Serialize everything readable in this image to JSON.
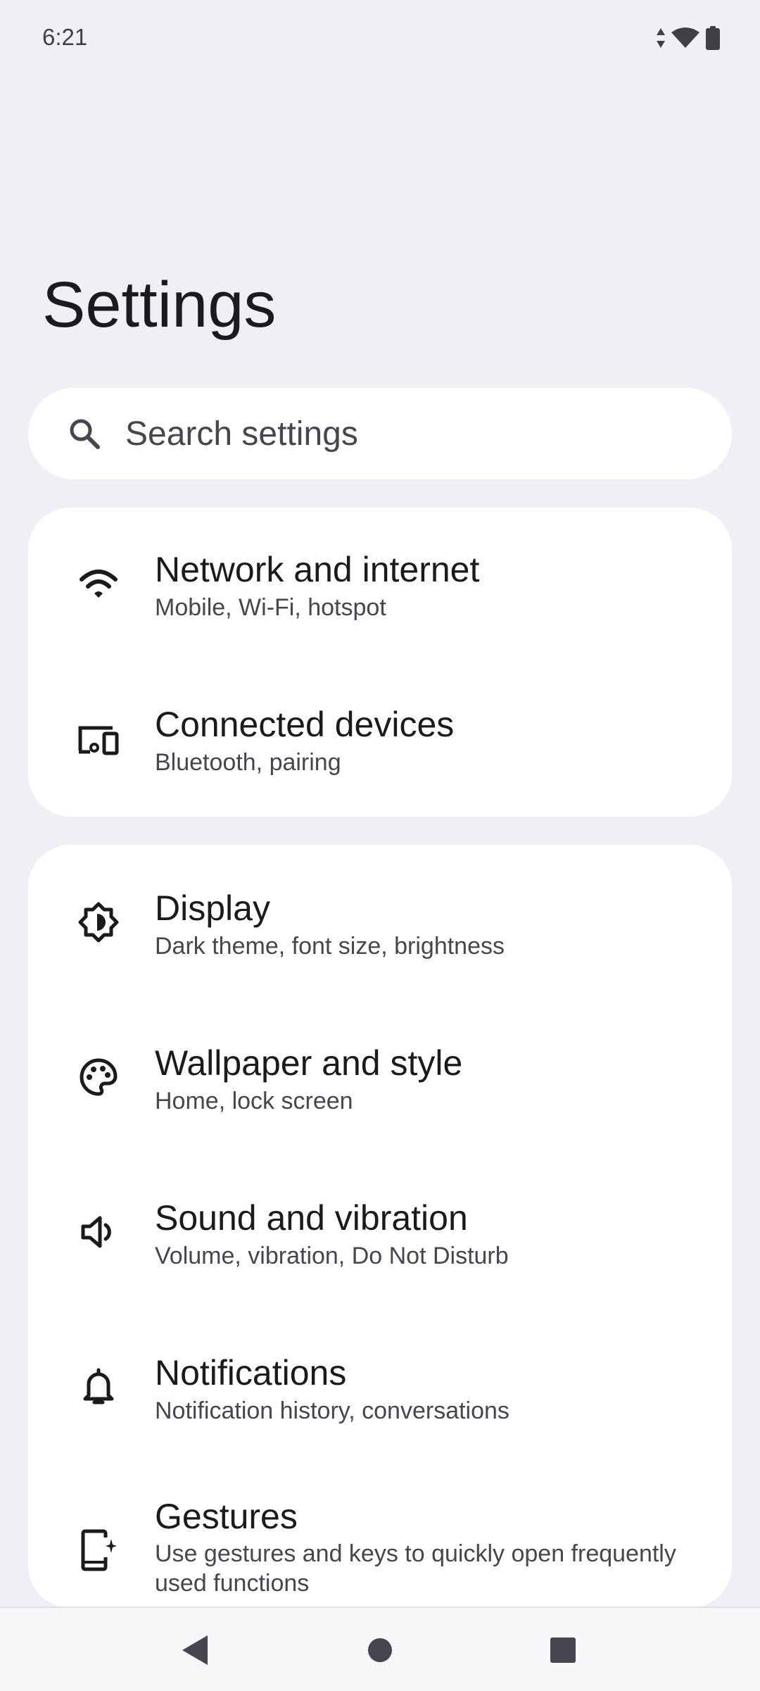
{
  "status_bar": {
    "time": "6:21",
    "icons": [
      "data-arrows-icon",
      "wifi-icon",
      "battery-icon"
    ]
  },
  "page": {
    "title": "Settings"
  },
  "search": {
    "label": "Search settings"
  },
  "groups": [
    {
      "items": [
        {
          "icon": "wifi-icon",
          "title": "Network and internet",
          "subtitle": "Mobile, Wi-Fi, hotspot"
        },
        {
          "icon": "devices-icon",
          "title": "Connected devices",
          "subtitle": "Bluetooth, pairing"
        }
      ]
    },
    {
      "items": [
        {
          "icon": "brightness-icon",
          "title": "Display",
          "subtitle": "Dark theme, font size, brightness"
        },
        {
          "icon": "palette-icon",
          "title": "Wallpaper and style",
          "subtitle": "Home, lock screen"
        },
        {
          "icon": "speaker-icon",
          "title": "Sound and vibration",
          "subtitle": "Volume, vibration, Do Not Disturb"
        },
        {
          "icon": "bell-icon",
          "title": "Notifications",
          "subtitle": "Notification history, conversations"
        },
        {
          "icon": "gestures-phone-icon",
          "title": "Gestures",
          "subtitle": "Use gestures and keys to quickly open frequently used functions"
        }
      ]
    }
  ],
  "nav_bar": {
    "buttons": [
      "back-icon",
      "home-icon",
      "recents-icon"
    ]
  },
  "colors": {
    "background": "#efeff5",
    "card": "#ffffff",
    "text_primary": "#1b1b1f",
    "text_secondary": "#45464f"
  }
}
